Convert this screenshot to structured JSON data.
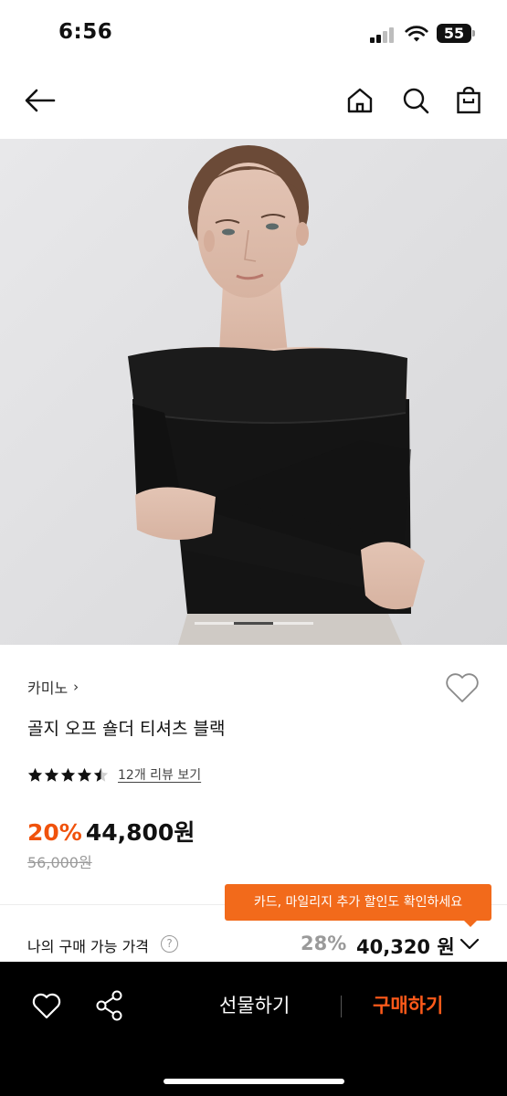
{
  "status_bar": {
    "time": "6:56",
    "battery": "55"
  },
  "nav": {
    "back_icon": "arrow-left-icon",
    "home_icon": "home-icon",
    "search_icon": "search-icon",
    "bag_icon": "shopping-bag-icon"
  },
  "hero": {
    "image": "model-wearing-black-off-shoulder-top",
    "page_index": 2,
    "page_count": 3
  },
  "product": {
    "brand": "카미노",
    "brand_chevron": "›",
    "title": "골지 오프 숄더 티셔츠 블랙",
    "rating_value": 4.5,
    "review_link": "12개 리뷰 보기",
    "discount_rate": "20%",
    "sale_price": "44,800원",
    "original_price": "56,000원"
  },
  "benefit": {
    "tooltip": "카드, 마일리지 추가 할인도 확인하세요",
    "my_price_label": "나의 구매 가능 가격",
    "help_glyph": "?",
    "my_rate": "28%",
    "my_price": "40,320 원"
  },
  "bottom_bar": {
    "gift_label": "선물하기",
    "buy_label": "구매하기"
  },
  "colors": {
    "accent": "#f0520c",
    "tooltip_bg": "#f26a1b",
    "bottom_bar_bg": "#000000"
  }
}
